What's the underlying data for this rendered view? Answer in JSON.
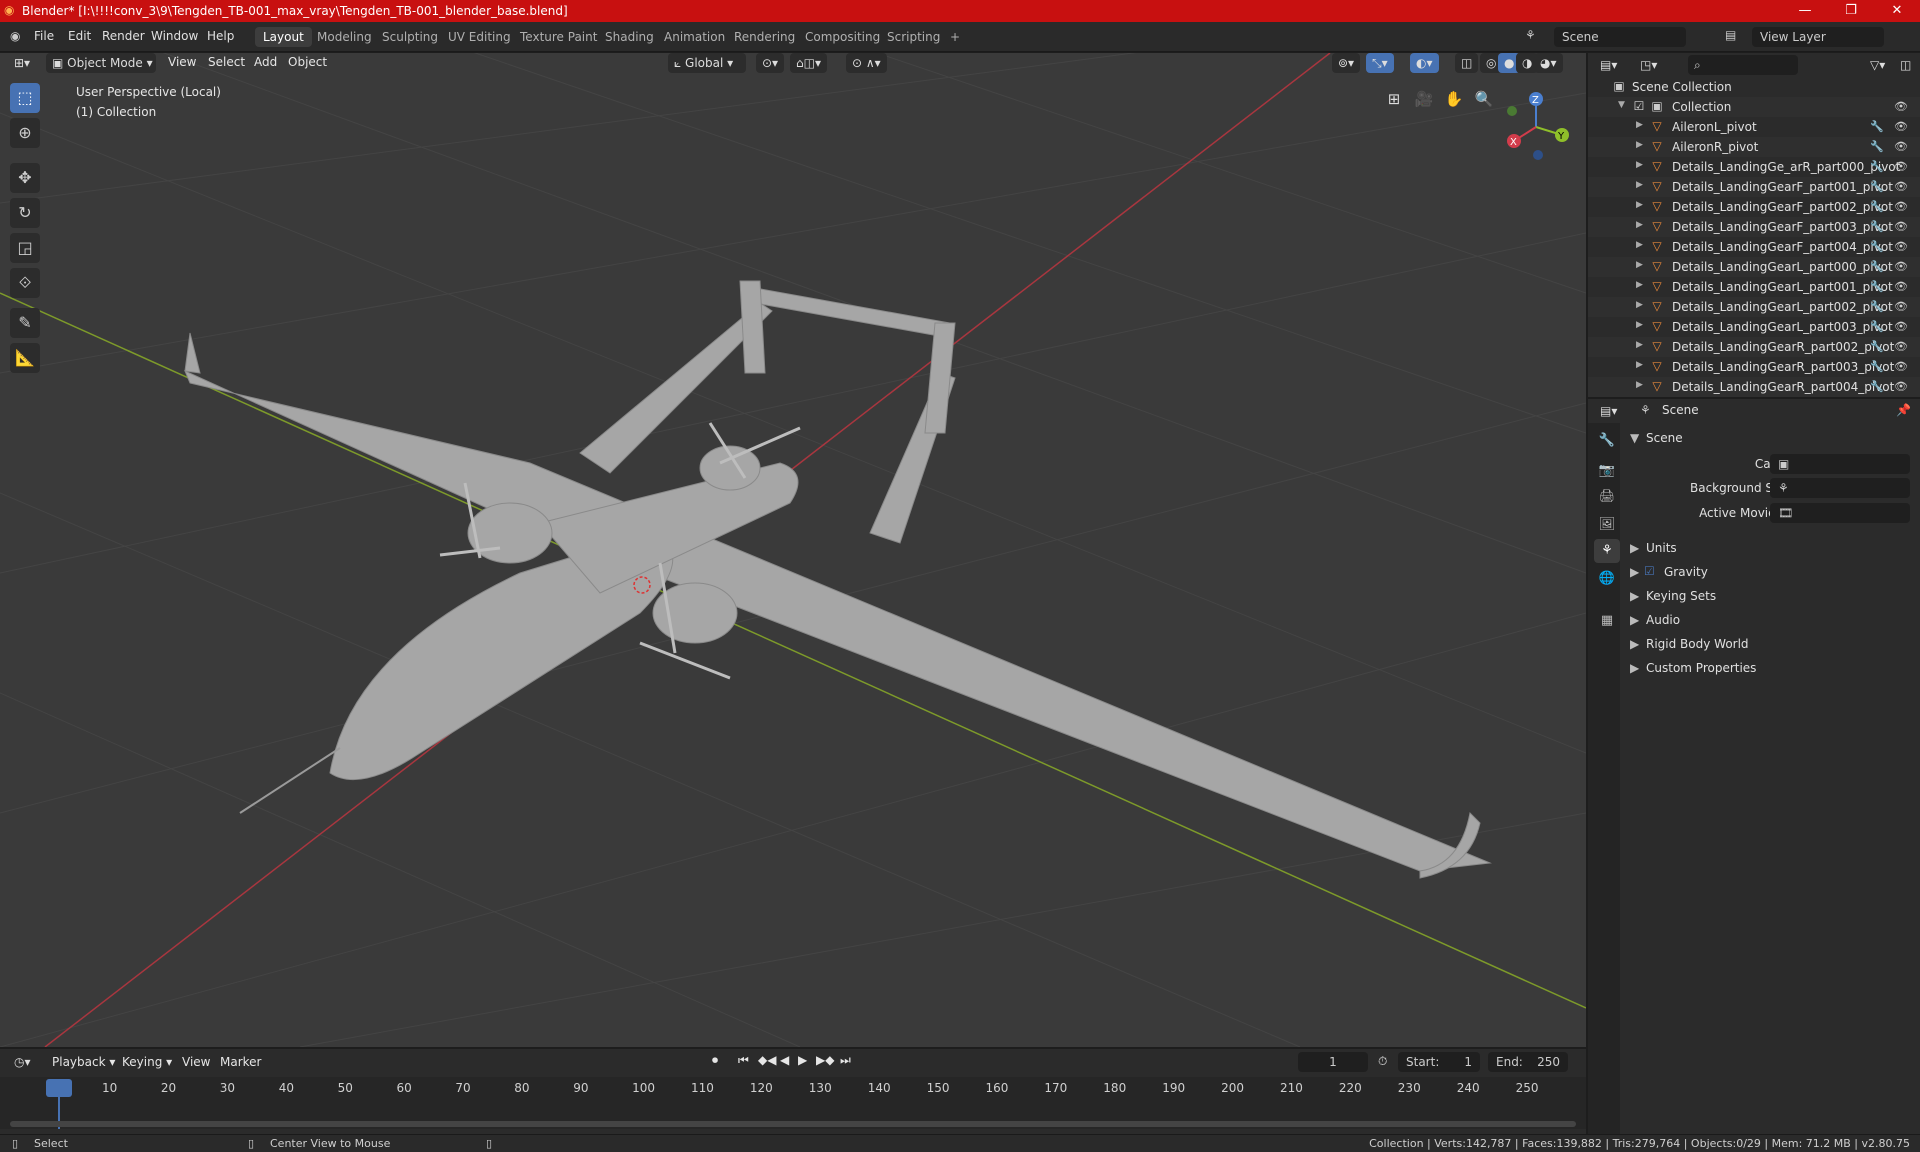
{
  "window": {
    "title": "Blender* [I:\\!!!!conv_3\\9\\Tengden_TB-001_max_vray\\Tengden_TB-001_blender_base.blend]",
    "minimize": "—",
    "maximize": "❐",
    "close": "✕"
  },
  "menu": [
    "File",
    "Edit",
    "Render",
    "Window",
    "Help"
  ],
  "workspaces": [
    "Layout",
    "Modeling",
    "Sculpting",
    "UV Editing",
    "Texture Paint",
    "Shading",
    "Animation",
    "Rendering",
    "Compositing",
    "Scripting",
    "+"
  ],
  "topbar": {
    "scene": "Scene",
    "view_layer": "View Layer"
  },
  "viewport": {
    "mode": "Object Mode",
    "menus": [
      "View",
      "Select",
      "Add",
      "Object"
    ],
    "transform_orientation": "Global",
    "info_line1": "User Perspective (Local)",
    "info_line2": "(1) Collection",
    "gizmo": {
      "x": "X",
      "y": "Y",
      "z": "Z"
    }
  },
  "outliner": {
    "root": "Scene Collection",
    "collection": "Collection",
    "items": [
      "AileronL_pivot",
      "AileronR_pivot",
      "Details_LandingGe_arR_part000_pivot",
      "Details_LandingGearF_part001_pivot",
      "Details_LandingGearF_part002_pivot",
      "Details_LandingGearF_part003_pivot",
      "Details_LandingGearF_part004_pivot",
      "Details_LandingGearL_part000_pivot",
      "Details_LandingGearL_part001_pivot",
      "Details_LandingGearL_part002_pivot",
      "Details_LandingGearL_part003_pivot",
      "Details_LandingGearR_part002_pivot",
      "Details_LandingGearR_part003_pivot",
      "Details_LandingGearR_part004_pivot"
    ]
  },
  "properties": {
    "header": "Scene",
    "section": "Scene",
    "camera_label": "Camera",
    "background_label": "Background Scene",
    "movieclip_label": "Active Movie Clip",
    "subpanels": [
      "Units",
      "Gravity",
      "Keying Sets",
      "Audio",
      "Rigid Body World",
      "Custom Properties"
    ]
  },
  "timeline": {
    "menus": [
      "Playback",
      "Keying",
      "View",
      "Marker"
    ],
    "current_frame": "1",
    "start_label": "Start:",
    "start": "1",
    "end_label": "End:",
    "end": "250",
    "ticks": [
      "1",
      "10",
      "20",
      "30",
      "40",
      "50",
      "60",
      "70",
      "80",
      "90",
      "100",
      "110",
      "120",
      "130",
      "140",
      "150",
      "160",
      "170",
      "180",
      "190",
      "200",
      "210",
      "220",
      "230",
      "240",
      "250"
    ]
  },
  "statusbar": {
    "select": "Select",
    "center": "Center View to Mouse",
    "stats": "Collection | Verts:142,787 | Faces:139,882 | Tris:279,764 | Objects:0/29 | Mem: 71.2 MB | v2.80.75"
  },
  "colors": {
    "accent": "#4772b3",
    "titlebar": "#c81010",
    "object_icon": "#e8883a"
  }
}
